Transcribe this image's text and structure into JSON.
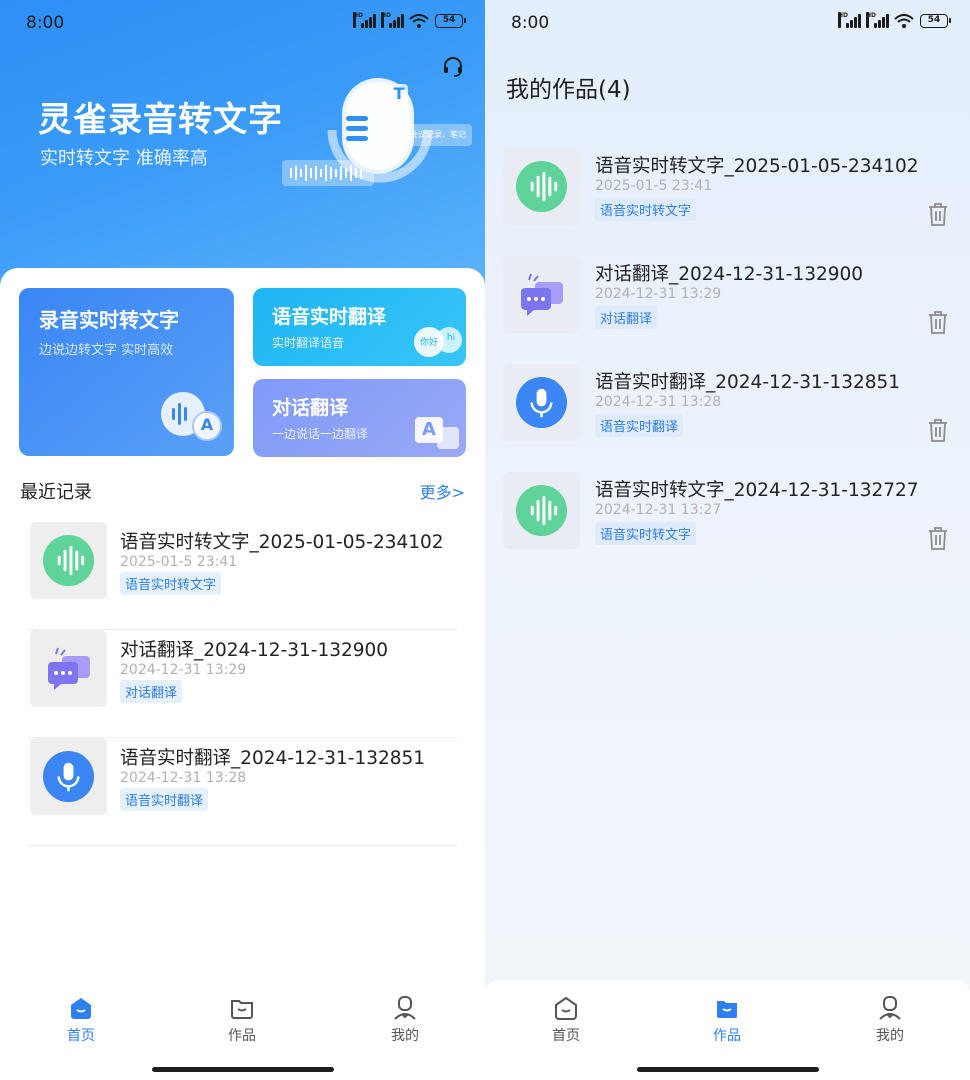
{
  "status": {
    "time": "8:00",
    "battery": "54",
    "hd": "HD"
  },
  "home": {
    "hero": {
      "title": "灵雀录音转文字",
      "subtitle": "实时转文字 准确率高",
      "art_text": "会议记录、笔记",
      "art_letter": "T"
    },
    "features": [
      {
        "title": "录音实时转文字",
        "subtitle": "边说边转文字 实时高效",
        "icon": "speech-to-text-icon",
        "icon_letter": "A"
      },
      {
        "title": "语音实时翻译",
        "subtitle": "实时翻译语音",
        "icon": "translate-bubbles-icon",
        "icon_text_a": "你好",
        "icon_text_b": "hi"
      },
      {
        "title": "对话翻译",
        "subtitle": "一边说话一边翻译",
        "icon": "dialogue-translate-icon",
        "icon_letter": "A"
      }
    ],
    "recent": {
      "title": "最近记录",
      "more": "更多>",
      "items": [
        {
          "name": "语音实时转文字_2025-01-05-234102",
          "date": "2025-01-5 23:41",
          "tag": "语音实时转文字",
          "icon": "waveform-icon"
        },
        {
          "name": "对话翻译_2024-12-31-132900",
          "date": "2024-12-31 13:29",
          "tag": "对话翻译",
          "icon": "chat-bubbles-icon"
        },
        {
          "name": "语音实时翻译_2024-12-31-132851",
          "date": "2024-12-31 13:28",
          "tag": "语音实时翻译",
          "icon": "microphone-icon"
        }
      ]
    }
  },
  "works": {
    "title": "我的作品(4)",
    "items": [
      {
        "name": "语音实时转文字_2025-01-05-234102",
        "date": "2025-01-5 23:41",
        "tag": "语音实时转文字",
        "icon": "waveform-icon"
      },
      {
        "name": "对话翻译_2024-12-31-132900",
        "date": "2024-12-31 13:29",
        "tag": "对话翻译",
        "icon": "chat-bubbles-icon"
      },
      {
        "name": "语音实时翻译_2024-12-31-132851",
        "date": "2024-12-31 13:28",
        "tag": "语音实时翻译",
        "icon": "microphone-icon"
      },
      {
        "name": "语音实时转文字_2024-12-31-132727",
        "date": "2024-12-31 13:27",
        "tag": "语音实时转文字",
        "icon": "waveform-icon"
      }
    ]
  },
  "tabs": [
    {
      "label": "首页",
      "icon": "home-icon"
    },
    {
      "label": "作品",
      "icon": "folder-icon"
    },
    {
      "label": "我的",
      "icon": "profile-icon"
    }
  ],
  "colors": {
    "primary": "#2f7ff0",
    "waveform": "#5fd39a",
    "chat": "#7d74f0",
    "mic": "#3b86f3"
  }
}
